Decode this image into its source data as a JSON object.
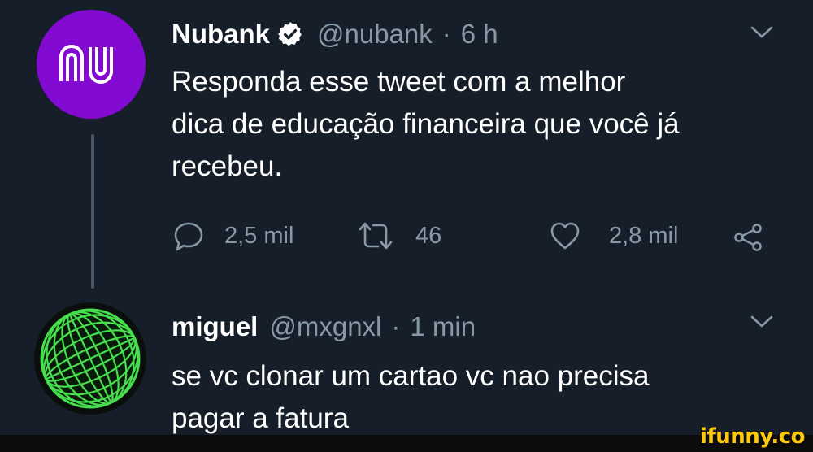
{
  "colors": {
    "background": "#161e29",
    "nubank_purple": "#820ad1",
    "muted_text": "#8899a6",
    "watermark": "#ffc90e"
  },
  "tweets": [
    {
      "avatar_icon": "nubank-logo-icon",
      "name": "Nubank",
      "verified": true,
      "handle": "@nubank",
      "separator": "·",
      "time": "6 h",
      "text_lines": [
        "Responda esse tweet com a melhor",
        "dica de educação financeira que você já",
        "recebeu."
      ],
      "actions": {
        "replies": "2,5 mil",
        "retweets": "46",
        "likes": "2,8 mil"
      }
    },
    {
      "avatar_icon": "green-wireframe-globe-icon",
      "name": "miguel",
      "handle": "@mxgnxl",
      "separator": "·",
      "time": "1 min",
      "text_lines": [
        "se vc clonar um cartao vc nao precisa",
        "pagar a fatura"
      ]
    }
  ],
  "watermark": "ifunny.co"
}
